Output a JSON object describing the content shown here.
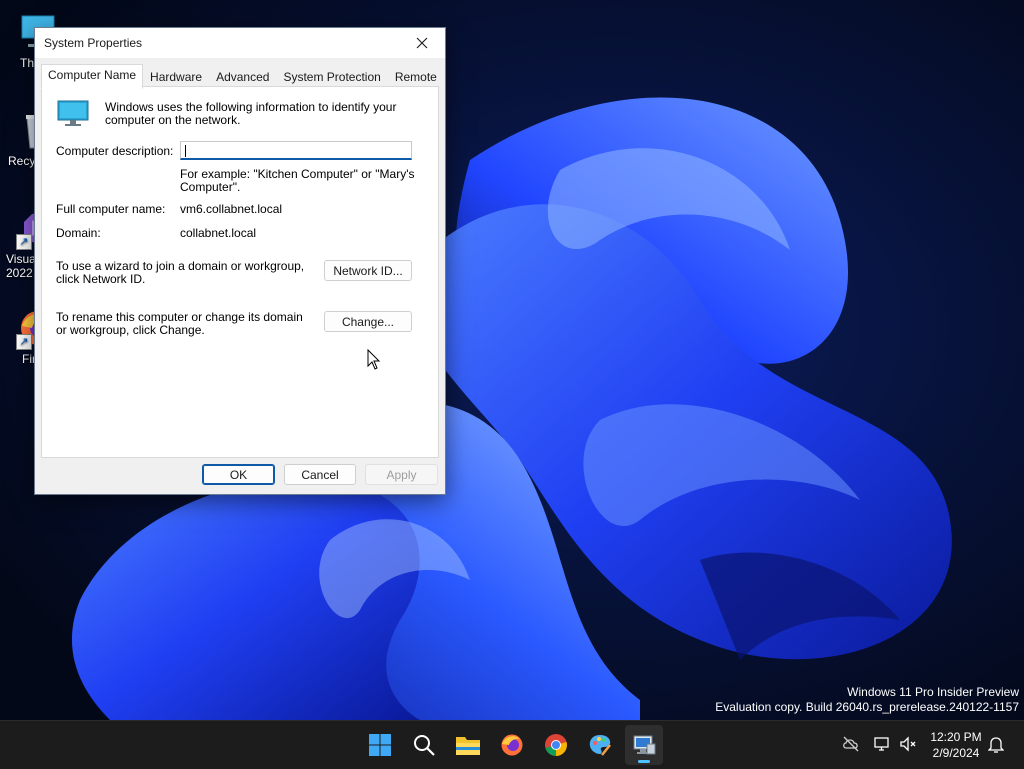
{
  "desktop": {
    "icons": [
      {
        "label": "Th",
        "icon": "this-pc-icon"
      },
      {
        "label": "Recy",
        "icon": "recycle-bin-icon"
      },
      {
        "label": "Visua\n2022",
        "icon": "visual-studio-icon"
      },
      {
        "label": "Fir",
        "icon": "firefox-icon"
      }
    ]
  },
  "dialog": {
    "title": "System Properties",
    "tabs": [
      "Computer Name",
      "Hardware",
      "Advanced",
      "System Protection",
      "Remote"
    ],
    "active_tab": "Computer Name",
    "info_text": "Windows uses the following information to identify your computer on the network.",
    "computer_description_label": "Computer description:",
    "computer_description_value": "",
    "example_text": "For example: \"Kitchen Computer\" or \"Mary's Computer\".",
    "full_name_label": "Full computer name:",
    "full_name_value": "vm6.collabnet.local",
    "domain_label": "Domain:",
    "domain_value": "collabnet.local",
    "network_id_text": "To use a wizard to join a domain or workgroup, click Network ID.",
    "network_id_button": "Network ID...",
    "change_text": "To rename this computer or change its domain or workgroup, click Change.",
    "change_button": "Change...",
    "ok_button": "OK",
    "cancel_button": "Cancel",
    "apply_button": "Apply"
  },
  "watermark": {
    "line1": "Windows 11 Pro Insider Preview",
    "line2": "Evaluation copy. Build 26040.rs_prerelease.240122-1157"
  },
  "taskbar": {
    "apps": [
      "start-icon",
      "search-icon",
      "file-explorer-icon",
      "firefox-icon",
      "chrome-icon",
      "paint-icon",
      "system-properties-icon"
    ],
    "time": "12:20 PM",
    "date": "2/9/2024"
  },
  "colors": {
    "accent": "#0f5aa6",
    "wallpaper_dark": "#050b24",
    "wallpaper_blue": "#1f4fff",
    "taskbar": "#1c1c1c"
  }
}
